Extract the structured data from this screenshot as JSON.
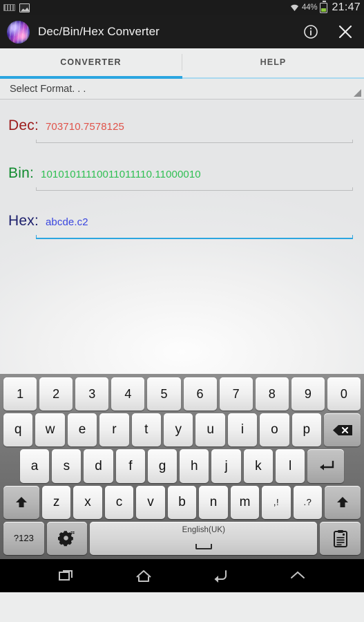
{
  "status_bar": {
    "left_icons": [
      "keyboard-icon",
      "screenshot-image-icon"
    ],
    "wifi_icon": "wifi-icon",
    "battery_percent": "44%",
    "battery_icon": "battery-icon",
    "clock": "21:47"
  },
  "app_bar": {
    "icon": "app-logo-icon",
    "title": "Dec/Bin/Hex Converter",
    "info_icon": "info-icon",
    "close_icon": "close-icon"
  },
  "tabs": [
    {
      "label": "CONVERTER",
      "active": true
    },
    {
      "label": "HELP",
      "active": false
    }
  ],
  "spinner": {
    "label": "Select Format. . .",
    "arrow_icon": "dropdown-triangle-icon"
  },
  "fields": [
    {
      "label": "Dec:",
      "value": "703710.7578125",
      "focused": false
    },
    {
      "label": "Bin:",
      "value": "10101011110011011110.11000010",
      "focused": false
    },
    {
      "label": "Hex:",
      "value": "abcde.c2",
      "focused": true
    }
  ],
  "colors": {
    "accent": "#2ba6e0",
    "dec_label": "#9c1b1b",
    "dec_value": "#e0534a",
    "bin_label": "#108a2e",
    "bin_value": "#2fbf52",
    "hex_label": "#1c1f6b",
    "hex_value": "#3a46df",
    "battery_fill": "#8cc63f"
  },
  "keyboard": {
    "row_numbers": [
      "1",
      "2",
      "3",
      "4",
      "5",
      "6",
      "7",
      "8",
      "9",
      "0"
    ],
    "row_qwerty": [
      "q",
      "w",
      "e",
      "r",
      "t",
      "y",
      "u",
      "i",
      "o",
      "p"
    ],
    "row_home": [
      "a",
      "s",
      "d",
      "f",
      "g",
      "h",
      "j",
      "k",
      "l"
    ],
    "row_bottom": [
      "z",
      "x",
      "c",
      "v",
      "b",
      "n",
      "m"
    ],
    "punct_comma": ",!",
    "punct_period": ".?",
    "backspace_icon": "backspace-icon",
    "enter_icon": "enter-icon",
    "shift_left_icon": "shift-icon",
    "shift_right_icon": "shift-icon",
    "symbols_label": "?123",
    "settings_icon": "gear-icon",
    "space_label": "English(UK)",
    "clipboard_icon": "clipboard-icon"
  },
  "nav_bar": {
    "recents_icon": "recents-icon",
    "home_icon": "home-icon",
    "back_icon": "back-icon",
    "hide_keyboard_icon": "chevron-down-icon"
  }
}
